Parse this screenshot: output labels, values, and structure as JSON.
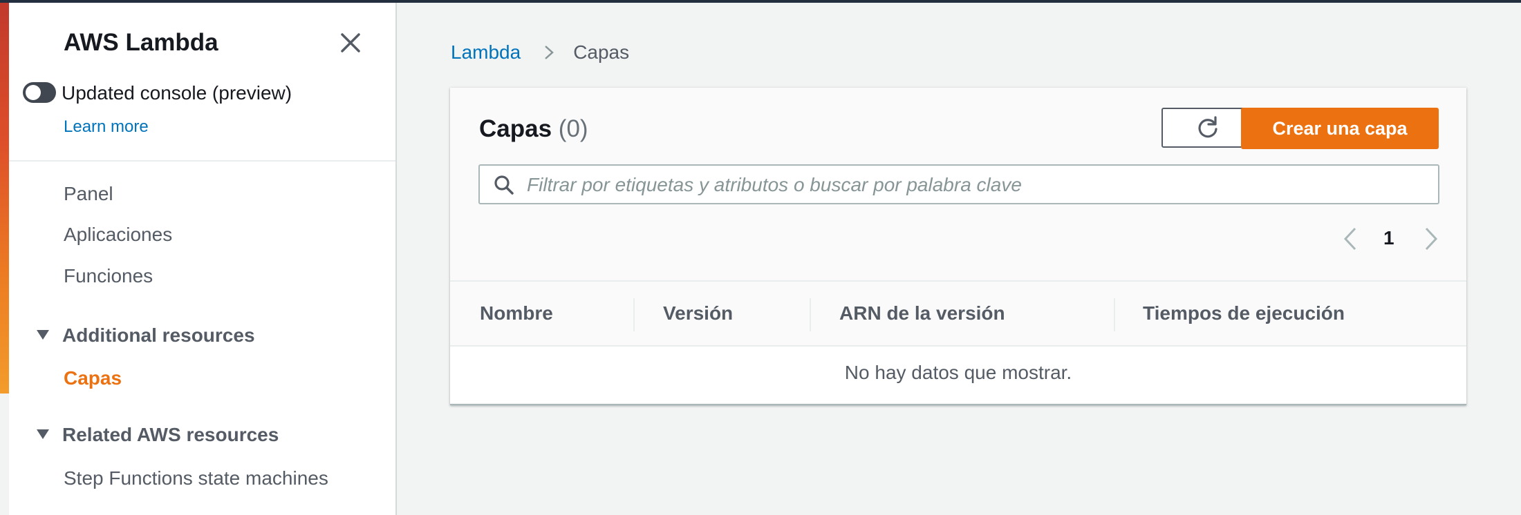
{
  "sidebar": {
    "title": "AWS Lambda",
    "toggle_label": "Updated console (preview)",
    "toggle_on": false,
    "learn_more": "Learn more",
    "items": [
      {
        "label": "Panel"
      },
      {
        "label": "Aplicaciones"
      },
      {
        "label": "Funciones"
      }
    ],
    "sections": [
      {
        "label": "Additional resources",
        "items": [
          {
            "label": "Capas",
            "active": true
          }
        ]
      },
      {
        "label": "Related AWS resources",
        "items": [
          {
            "label": "Step Functions state machines"
          }
        ]
      }
    ]
  },
  "breadcrumb": {
    "root": "Lambda",
    "current": "Capas"
  },
  "panel": {
    "title": "Capas",
    "count": "(0)",
    "create_button": "Crear una capa",
    "search_placeholder": "Filtrar por etiquetas y atributos o buscar por palabra clave",
    "page": "1",
    "columns": [
      "Nombre",
      "Versión",
      "ARN de la versión",
      "Tiempos de ejecución"
    ],
    "empty_message": "No hay datos que mostrar."
  },
  "colors": {
    "accent": "#ec7211",
    "link": "#0073bb",
    "header_bar": "#232f3e"
  },
  "icons": [
    "close-icon",
    "refresh-icon",
    "search-icon",
    "chevron-right-icon",
    "chevron-left-icon",
    "caret-down-icon"
  ]
}
